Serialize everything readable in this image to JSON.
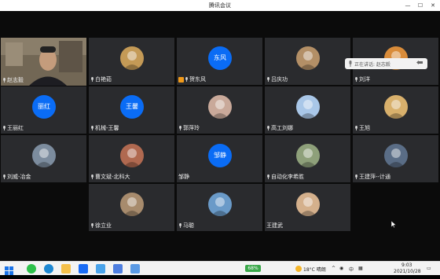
{
  "window": {
    "title": "腾讯会议"
  },
  "speaking": {
    "label": "正在讲话: 赵志毅"
  },
  "participants": [
    {
      "name": "赵志毅",
      "kind": "video"
    },
    {
      "name": "白艳茹",
      "kind": "photo"
    },
    {
      "name": "贺东风",
      "kind": "letter",
      "initials": "东风",
      "host": true
    },
    {
      "name": "吕庆功",
      "kind": "photo"
    },
    {
      "name": "刘洋",
      "kind": "photo"
    },
    {
      "name": "王丽红",
      "kind": "letter",
      "initials": "丽红"
    },
    {
      "name": "机械-王馨",
      "kind": "letter",
      "initials": "王馨"
    },
    {
      "name": "郭萍玲",
      "kind": "photo"
    },
    {
      "name": "高工刘娜",
      "kind": "photo"
    },
    {
      "name": "王旭",
      "kind": "photo"
    },
    {
      "name": "刘威-冶金",
      "kind": "photo"
    },
    {
      "name": "曹文斌-北科大",
      "kind": "photo"
    },
    {
      "name": "邹静",
      "kind": "letter",
      "initials": "邹静",
      "nomic": true
    },
    {
      "name": "自动化李希胜",
      "kind": "photo"
    },
    {
      "name": "王建萍--计通",
      "kind": "photo"
    },
    {
      "name": "徐立业",
      "kind": "photo"
    },
    {
      "name": "马聪",
      "kind": "photo"
    },
    {
      "name": "王建武",
      "kind": "photo",
      "nomic": true
    }
  ],
  "taskbar": {
    "battery": "68%",
    "weather": "18°C 晴朗",
    "lang": "中",
    "time": "9:03",
    "date": "2021/10/28"
  },
  "colors": {
    "accent": "#0a6cf5",
    "tile": "#2a2b2e"
  }
}
